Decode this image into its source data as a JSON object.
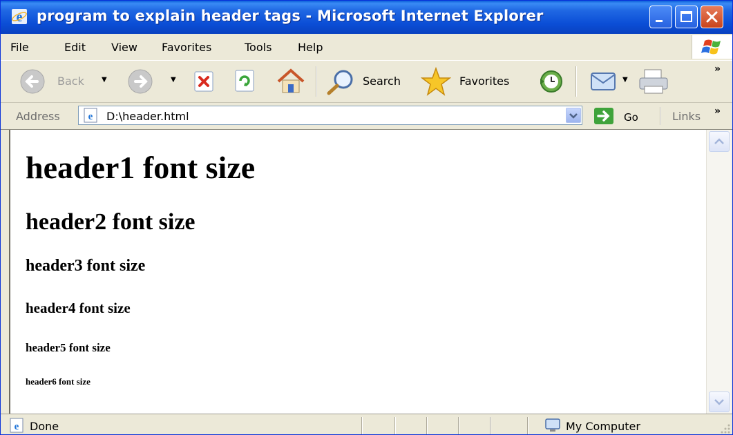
{
  "window": {
    "title": "program to explain header tags - Microsoft Internet Explorer"
  },
  "menu": {
    "items": [
      "File",
      "Edit",
      "View",
      "Favorites",
      "Tools",
      "Help"
    ]
  },
  "toolbar": {
    "back_label": "Back",
    "search_label": "Search",
    "favorites_label": "Favorites",
    "more": "»"
  },
  "address": {
    "label": "Address",
    "url": "D:\\header.html",
    "go_label": "Go",
    "links_label": "Links",
    "more": "»"
  },
  "page": {
    "h1": "header1 font size",
    "h2": "header2 font size",
    "h3": "header3 font size",
    "h4": "header4 font size",
    "h5": "header5 font size",
    "h6": "header6 font size"
  },
  "status": {
    "text": "Done",
    "zone": "My Computer"
  },
  "colors": {
    "titlebar": "#0B4ED6",
    "chrome": "#ECE9D8",
    "close_button": "#C9441C"
  }
}
